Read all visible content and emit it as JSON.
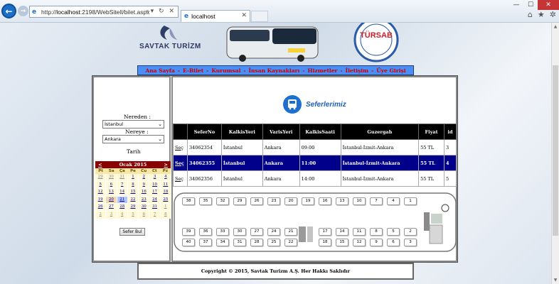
{
  "browser": {
    "url_prefix": "http://",
    "url_host": "localhost",
    "url_rest": ":2198/WebSitell/bilet.aspx",
    "tab_title": "localhost"
  },
  "header": {
    "logo": "SAVTAK TURİZM",
    "tursab": "TÜRSAB"
  },
  "menu": {
    "items": [
      "Ana Sayfa",
      "E-Bilet",
      "Kurumsal",
      "İnsan Kaynakları",
      "Hizmetler",
      "İletişim",
      "Üye Girişi"
    ]
  },
  "search": {
    "from_label": "Nereden :",
    "from_value": "İstanbul",
    "to_label": "Nereye :",
    "to_value": "Ankara",
    "date_label": "Tarih",
    "button": "Sefer Bul"
  },
  "calendar": {
    "prev": "<",
    "title": "Ocak 2015",
    "next": ">",
    "days": [
      "Pt",
      "Sa",
      "Ça",
      "Pe",
      "Cu",
      "Ct",
      "Pz"
    ],
    "dates": [
      "29",
      "30",
      "31",
      "1",
      "2",
      "3",
      "4",
      "5",
      "6",
      "7",
      "8",
      "9",
      "10",
      "11",
      "12",
      "13",
      "14",
      "15",
      "16",
      "17",
      "18",
      "19",
      "20",
      "21",
      "22",
      "23",
      "24",
      "25",
      "26",
      "27",
      "28",
      "29",
      "30",
      "31",
      "1",
      "2",
      "3",
      "4",
      "5",
      "6",
      "7",
      "8"
    ]
  },
  "trips": {
    "title": "Seferlerimiz",
    "headers": [
      "",
      "SeferNo",
      "KalkisYeri",
      "VarisYeri",
      "KalkisSaati",
      "Guzergah",
      "Fiyat",
      "id"
    ],
    "rows": [
      [
        "Seç",
        "34062354",
        "İstanbul",
        "Ankara",
        "09:00",
        "İstanbul-İzmit-Ankara",
        "55 TL",
        "3"
      ],
      [
        "Seç",
        "34062355",
        "İstanbul",
        "Ankara",
        "11:00",
        "İstanbul-İzmit-Ankara",
        "55 TL",
        "4"
      ],
      [
        "Seç",
        "34062356",
        "İstanbul",
        "Ankara",
        "14:00",
        "İstanbul-İzmit-Ankara",
        "55 TL",
        "5"
      ]
    ],
    "selected_row": 1
  },
  "bus": {
    "row1": [
      "38",
      "35",
      "32",
      "29",
      "26",
      "23",
      "20",
      "19",
      "16",
      "13",
      "10",
      "7",
      "4",
      "1"
    ],
    "row2": [
      "39",
      "36",
      "33",
      "30",
      "27",
      "24",
      "21",
      "17",
      "14",
      "11",
      "8",
      "5",
      "2"
    ],
    "row3": [
      "40",
      "37",
      "34",
      "31",
      "28",
      "25",
      "22",
      "18",
      "15",
      "12",
      "9",
      "6",
      "3"
    ]
  },
  "footer": {
    "text": "Copyright © 2015, Savtak Turizm A.Ş. Her Hakkı Saklıdır"
  }
}
